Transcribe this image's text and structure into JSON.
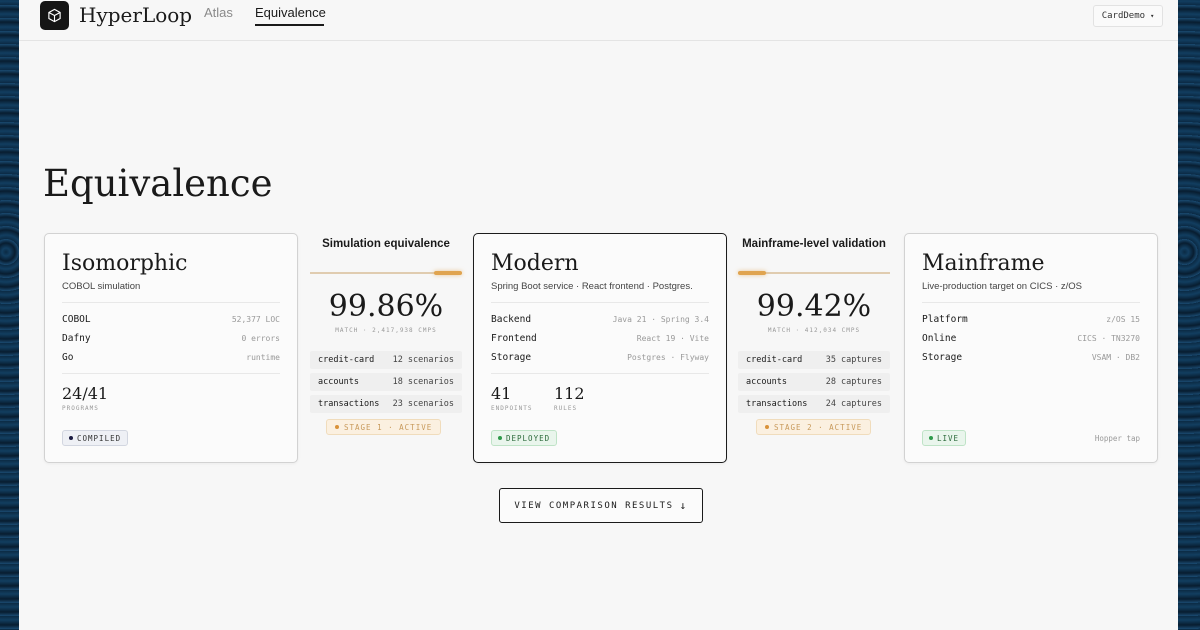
{
  "header": {
    "brand": "HyperLoop",
    "nav": [
      {
        "label": "Atlas",
        "active": false
      },
      {
        "label": "Equivalence",
        "active": true
      }
    ],
    "project_select": {
      "value": "CardDemo",
      "icon": "chevron-down-icon"
    }
  },
  "page": {
    "title": "Equivalence"
  },
  "cards": {
    "isomorphic": {
      "title": "Isomorphic",
      "subtitle": "COBOL simulation",
      "rows": [
        {
          "key": "COBOL",
          "value": "52,377 LOC"
        },
        {
          "key": "Dafny",
          "value": "0 errors"
        },
        {
          "key": "Go",
          "value": "runtime"
        }
      ],
      "stat": {
        "value": "24/41",
        "label": "PROGRAMS"
      },
      "badge": "COMPILED"
    },
    "modern": {
      "title": "Modern",
      "subtitle": "Spring Boot service · React frontend · Postgres.",
      "rows": [
        {
          "key": "Backend",
          "value": "Java 21 · Spring 3.4"
        },
        {
          "key": "Frontend",
          "value": "React 19 · Vite"
        },
        {
          "key": "Storage",
          "value": "Postgres · Flyway"
        }
      ],
      "stats": [
        {
          "value": "41",
          "label": "ENDPOINTS"
        },
        {
          "value": "112",
          "label": "RULES"
        }
      ],
      "badge": "DEPLOYED"
    },
    "mainframe": {
      "title": "Mainframe",
      "subtitle": "Live-production target on CICS · z/OS",
      "rows": [
        {
          "key": "Platform",
          "value": "z/OS 15"
        },
        {
          "key": "Online",
          "value": "CICS · TN3270"
        },
        {
          "key": "Storage",
          "value": "VSAM · DB2"
        }
      ],
      "badge": "LIVE",
      "footnote": "Hopper tap"
    }
  },
  "connectors": {
    "simulation": {
      "title": "Simulation equivalence",
      "percent": "99.86%",
      "caption": "MATCH · 2,417,938 CMPS",
      "rows": [
        {
          "key": "credit-card",
          "value": "12 scenarios"
        },
        {
          "key": "accounts",
          "value": "18 scenarios"
        },
        {
          "key": "transactions",
          "value": "23 scenarios"
        }
      ],
      "stage": "STAGE 1 · ACTIVE"
    },
    "mainframe_validation": {
      "title": "Mainframe-level validation",
      "percent": "99.42%",
      "caption": "MATCH · 412,034 CMPS",
      "rows": [
        {
          "key": "credit-card",
          "value": "35 captures"
        },
        {
          "key": "accounts",
          "value": "28 captures"
        },
        {
          "key": "transactions",
          "value": "24 captures"
        }
      ],
      "stage": "STAGE 2 · ACTIVE"
    }
  },
  "cta": {
    "label": "VIEW COMPARISON RESULTS",
    "icon": "arrow-down-icon"
  },
  "colors": {
    "accent_amber": "#e0a450",
    "live_green": "#2e9a4a",
    "ink": "#1a1a1a"
  }
}
